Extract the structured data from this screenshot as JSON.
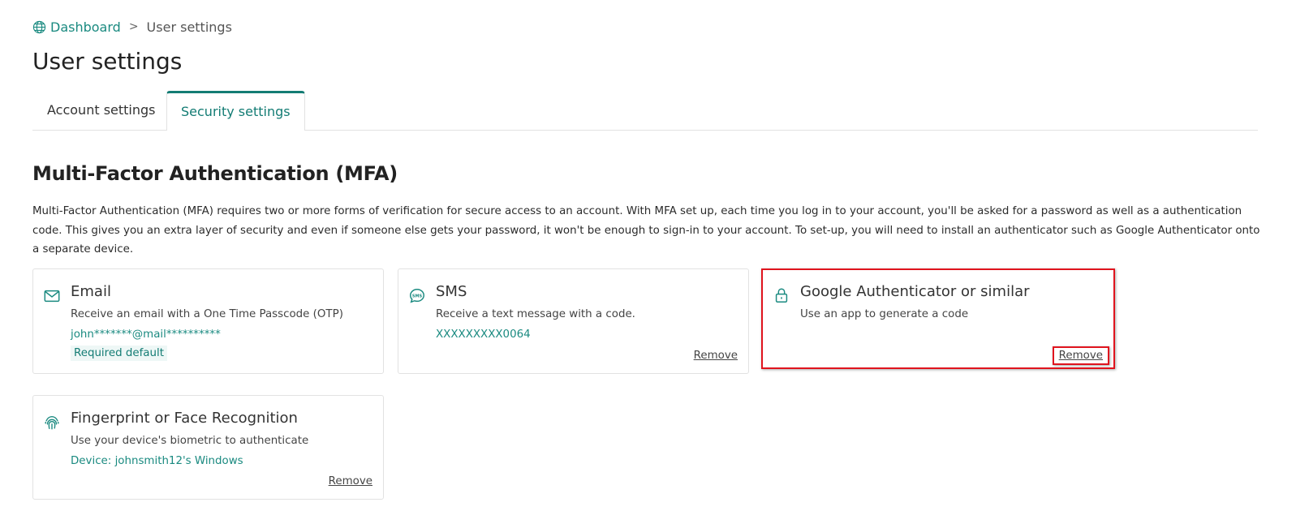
{
  "breadcrumb": {
    "home_label": "Dashboard",
    "separator": ">",
    "current": "User settings"
  },
  "page_title": "User settings",
  "tabs": [
    {
      "label": "Account settings",
      "active": false
    },
    {
      "label": "Security settings",
      "active": true
    }
  ],
  "mfa": {
    "title": "Multi-Factor Authentication (MFA)",
    "description": "Multi-Factor Authentication (MFA) requires two or more forms of verification for secure access to an account. With MFA set up, each time you log in to your account, you'll be asked for a password as well as a authentication code. This gives you an extra layer of security and even if someone else gets your password, it won't be enough to sign-in to your account. To set-up, you will need to install an authenticator such as Google Authenticator onto a separate device.",
    "methods": {
      "email": {
        "icon": "envelope-icon",
        "title": "Email",
        "description": "Receive an email with a One Time Passcode (OTP)",
        "detail": "john*******@mail**********",
        "badge": "Required default"
      },
      "sms": {
        "icon": "sms-chat-icon",
        "title": "SMS",
        "description": "Receive a text message with a code.",
        "detail": "XXXXXXXXX0064",
        "remove_label": "Remove"
      },
      "google": {
        "icon": "lock-icon",
        "title": "Google Authenticator or similar",
        "description": "Use an app to generate a code",
        "remove_label": "Remove",
        "highlight_color": "#e0141e"
      },
      "biometric": {
        "icon": "fingerprint-icon",
        "title": "Fingerprint or Face Recognition",
        "description": "Use your device's biometric to authenticate",
        "detail": "Device: johnsmith12's Windows",
        "remove_label": "Remove"
      }
    }
  },
  "colors": {
    "accent": "#137c74",
    "accent_light": "#1a8a80",
    "highlight": "#e0141e",
    "border": "#e2e2e2"
  }
}
